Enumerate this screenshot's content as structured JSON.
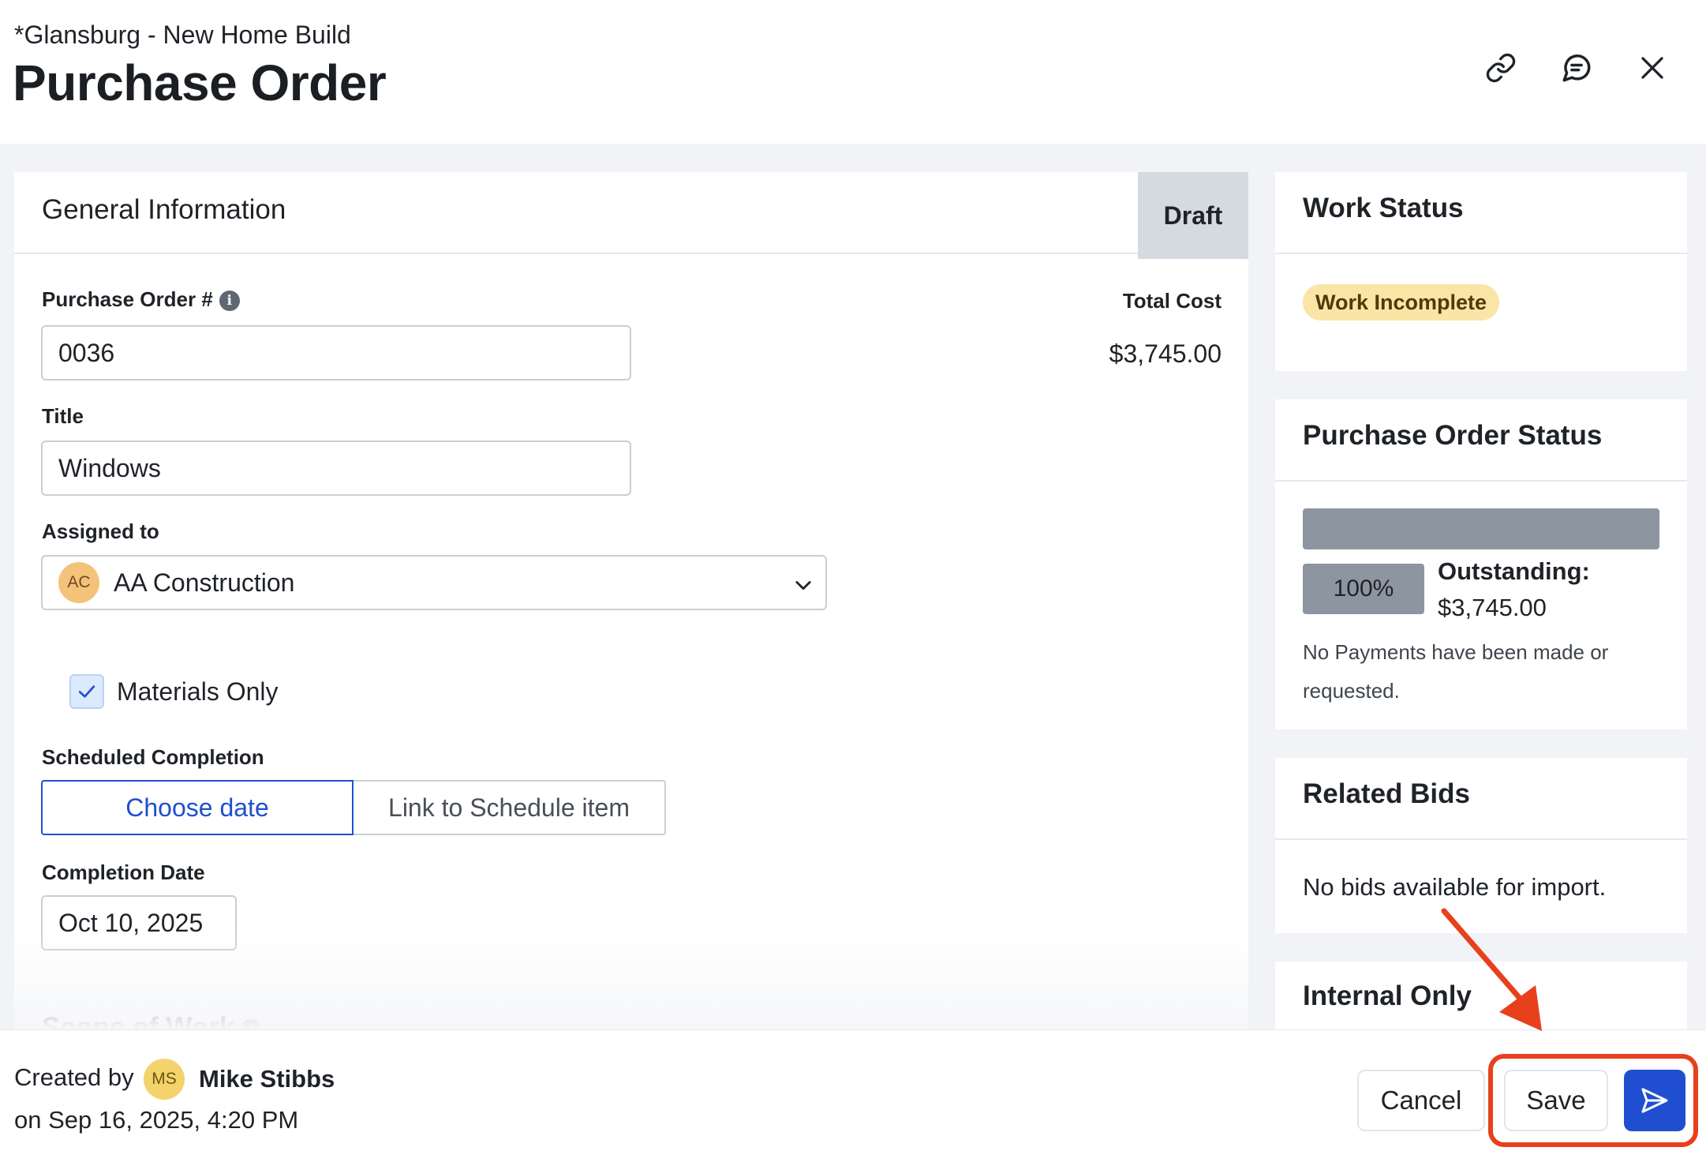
{
  "header": {
    "project": "*Glansburg - New Home Build",
    "title": "Purchase Order"
  },
  "general": {
    "title": "General Information",
    "status": "Draft",
    "po_label": "Purchase Order #",
    "po_value": "0036",
    "total_cost_label": "Total Cost",
    "total_cost_value": "$3,745.00",
    "title_label": "Title",
    "title_value": "Windows",
    "assigned_label": "Assigned to",
    "assigned_initials": "AC",
    "assigned_value": "AA Construction",
    "materials_only_label": "Materials Only",
    "materials_only_checked": true,
    "scheduled_label": "Scheduled Completion",
    "choose_date": "Choose date",
    "link_schedule": "Link to Schedule item",
    "completion_label": "Completion Date",
    "completion_value": "Oct 10, 2025",
    "scope_label": "Scope of Work"
  },
  "work_status": {
    "title": "Work Status",
    "badge": "Work Incomplete"
  },
  "po_status": {
    "title": "Purchase Order Status",
    "percent": "100%",
    "outstanding_label": "Outstanding:",
    "outstanding_value": "$3,745.00",
    "note": "No Payments have been made or requested."
  },
  "related_bids": {
    "title": "Related Bids",
    "empty": "No bids available for import."
  },
  "internal": {
    "title": "Internal Only"
  },
  "footer": {
    "created_by": "Created by",
    "creator_initials": "MS",
    "creator_name": "Mike Stibbs",
    "created_on": "on Sep 16, 2025, 4:20 PM",
    "cancel": "Cancel",
    "save": "Save"
  },
  "colors": {
    "primary": "#1f4fd0",
    "highlight": "#e8401c",
    "badge_bg": "#fbe5a6",
    "avatar_bg": "#f5c27a"
  },
  "icons": [
    "link-icon",
    "comment-icon",
    "close-icon",
    "chevron-down-icon",
    "check-icon",
    "send-icon",
    "info-icon"
  ]
}
